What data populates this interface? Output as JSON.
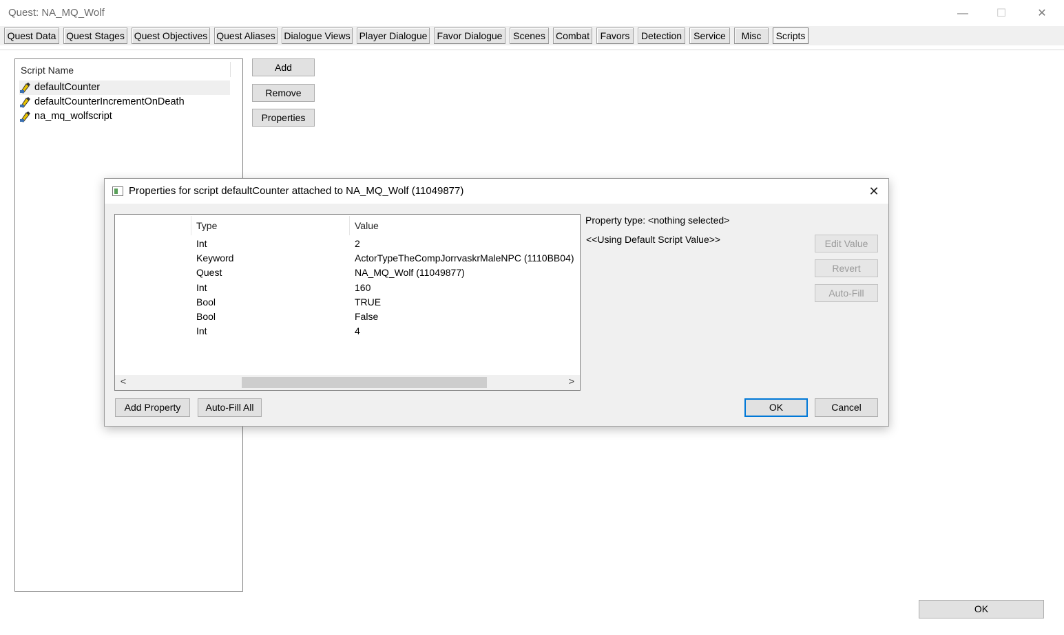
{
  "window": {
    "title": "Quest: NA_MQ_Wolf",
    "minimize_glyph": "—",
    "maximize_glyph": "☐",
    "close_glyph": "✕"
  },
  "tabs": [
    {
      "label": "Quest Data"
    },
    {
      "label": "Quest Stages"
    },
    {
      "label": "Quest Objectives"
    },
    {
      "label": "Quest Aliases"
    },
    {
      "label": "Dialogue Views"
    },
    {
      "label": "Player Dialogue"
    },
    {
      "label": "Favor Dialogue"
    },
    {
      "label": "Scenes"
    },
    {
      "label": "Combat"
    },
    {
      "label": "Favors"
    },
    {
      "label": "Detection"
    },
    {
      "label": "Service"
    },
    {
      "label": "Misc"
    },
    {
      "label": "Scripts",
      "active": true
    }
  ],
  "scripts_panel": {
    "header": "Script Name",
    "items": [
      {
        "name": "defaultCounter",
        "selected": true,
        "icon": "script-icon"
      },
      {
        "name": "defaultCounterIncrementOnDeath",
        "icon": "script-icon"
      },
      {
        "name": "na_mq_wolfscript",
        "icon": "script-icon"
      }
    ],
    "add_label": "Add",
    "remove_label": "Remove",
    "properties_label": "Properties"
  },
  "dialog": {
    "title": "Properties for script defaultCounter attached to NA_MQ_Wolf (11049877)",
    "close_glyph": "✕",
    "columns": {
      "name": "",
      "type": "Type",
      "value": "Value"
    },
    "rows": [
      {
        "type": "Int",
        "value": "2"
      },
      {
        "type": "Keyword",
        "value": "ActorTypeTheCompJorrvaskrMaleNPC (1110BB04)"
      },
      {
        "type": "Quest",
        "value": "NA_MQ_Wolf (11049877)"
      },
      {
        "type": "Int",
        "value": "160"
      },
      {
        "type": "Bool",
        "value": "TRUE"
      },
      {
        "type": "Bool",
        "value": "False"
      },
      {
        "type": "Int",
        "value": "4"
      }
    ],
    "scroll_left_glyph": "<",
    "scroll_right_glyph": ">",
    "property_type_text": "Property type: <nothing selected>",
    "default_value_text": "<<Using Default Script Value>>",
    "edit_value_label": "Edit Value",
    "revert_label": "Revert",
    "auto_fill_label": "Auto-Fill",
    "add_property_label": "Add Property",
    "auto_fill_all_label": "Auto-Fill All",
    "ok_label": "OK",
    "cancel_label": "Cancel"
  },
  "footer": {
    "ok_label": "OK"
  },
  "colors": {
    "accent": "#0078d7",
    "tab_bg": "#e4e4e4",
    "dialog_bg": "#f0f0f0"
  }
}
